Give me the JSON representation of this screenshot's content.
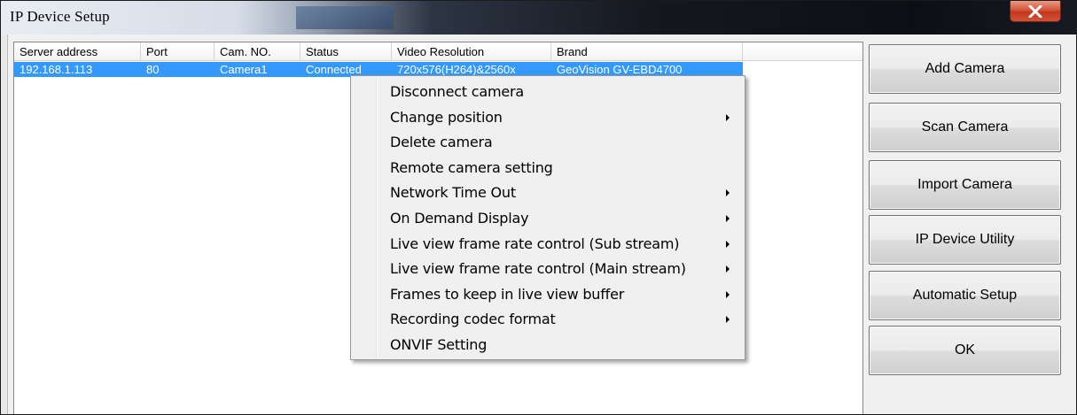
{
  "window": {
    "title": "IP Device Setup",
    "close_glyph": "close-icon"
  },
  "list": {
    "columns": [
      "Server address",
      "Port",
      "Cam. NO.",
      "Status",
      "Video Resolution",
      "Brand"
    ],
    "rows": [
      {
        "server_address": "192.168.1.113",
        "port": "80",
        "cam_no": "Camera1",
        "status": "Connected",
        "video_resolution": "720x576(H264)&2560x",
        "brand": "GeoVision GV-EBD4700"
      }
    ]
  },
  "context_menu": {
    "items": [
      {
        "label": "Disconnect camera",
        "submenu": false
      },
      {
        "label": "Change position",
        "submenu": true
      },
      {
        "label": "Delete camera",
        "submenu": false
      },
      {
        "label": "Remote camera setting",
        "submenu": false
      },
      {
        "label": "Network Time Out",
        "submenu": true
      },
      {
        "label": "On Demand Display",
        "submenu": true
      },
      {
        "label": "Live view frame rate control (Sub stream)",
        "submenu": true
      },
      {
        "label": "Live view frame rate control (Main stream)",
        "submenu": true
      },
      {
        "label": "Frames to keep in live view buffer",
        "submenu": true
      },
      {
        "label": "Recording codec format",
        "submenu": true
      },
      {
        "label": "ONVIF Setting",
        "submenu": false
      }
    ]
  },
  "buttons": {
    "add_camera": "Add Camera",
    "scan_camera": "Scan Camera",
    "import_camera": "Import Camera",
    "ip_device_utility": "IP Device Utility",
    "automatic_setup": "Automatic Setup",
    "ok": "OK"
  },
  "colors": {
    "selection": "#3399ff",
    "close_button": "#c7402a"
  }
}
